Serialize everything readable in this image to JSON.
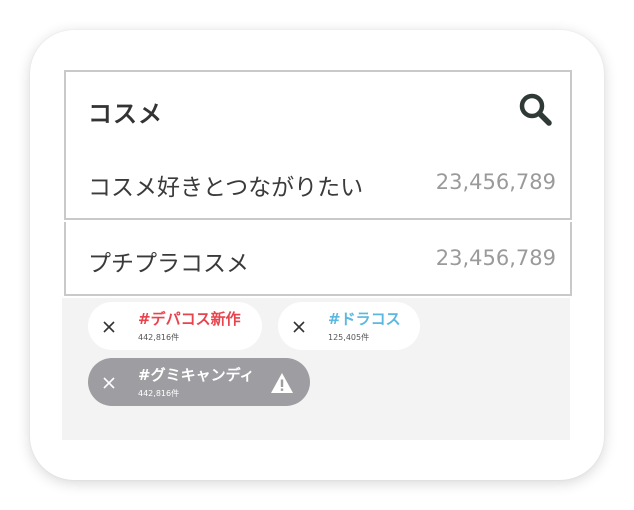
{
  "search": {
    "query": "コスメ",
    "icon": "search-icon"
  },
  "suggestions": [
    {
      "label": "コスメ好きとつながりたい",
      "count": "23,456,789"
    },
    {
      "label": "プチプラコスメ",
      "count": "23,456,789"
    }
  ],
  "chips": [
    {
      "tag": "#デパコス新作",
      "count": "442,816件",
      "color": "#e8444e"
    },
    {
      "tag": "#ドラコス",
      "count": "125,405件",
      "color": "#5bb8df"
    },
    {
      "tag": "#グミキャンディ",
      "count": "442,816件",
      "color": "#ffffff",
      "warning_icon": "warning-icon"
    }
  ],
  "colors": {
    "border": "#c9c9c9",
    "chip_area": "#f3f3f3",
    "disabled_chip": "#9e9da2"
  }
}
